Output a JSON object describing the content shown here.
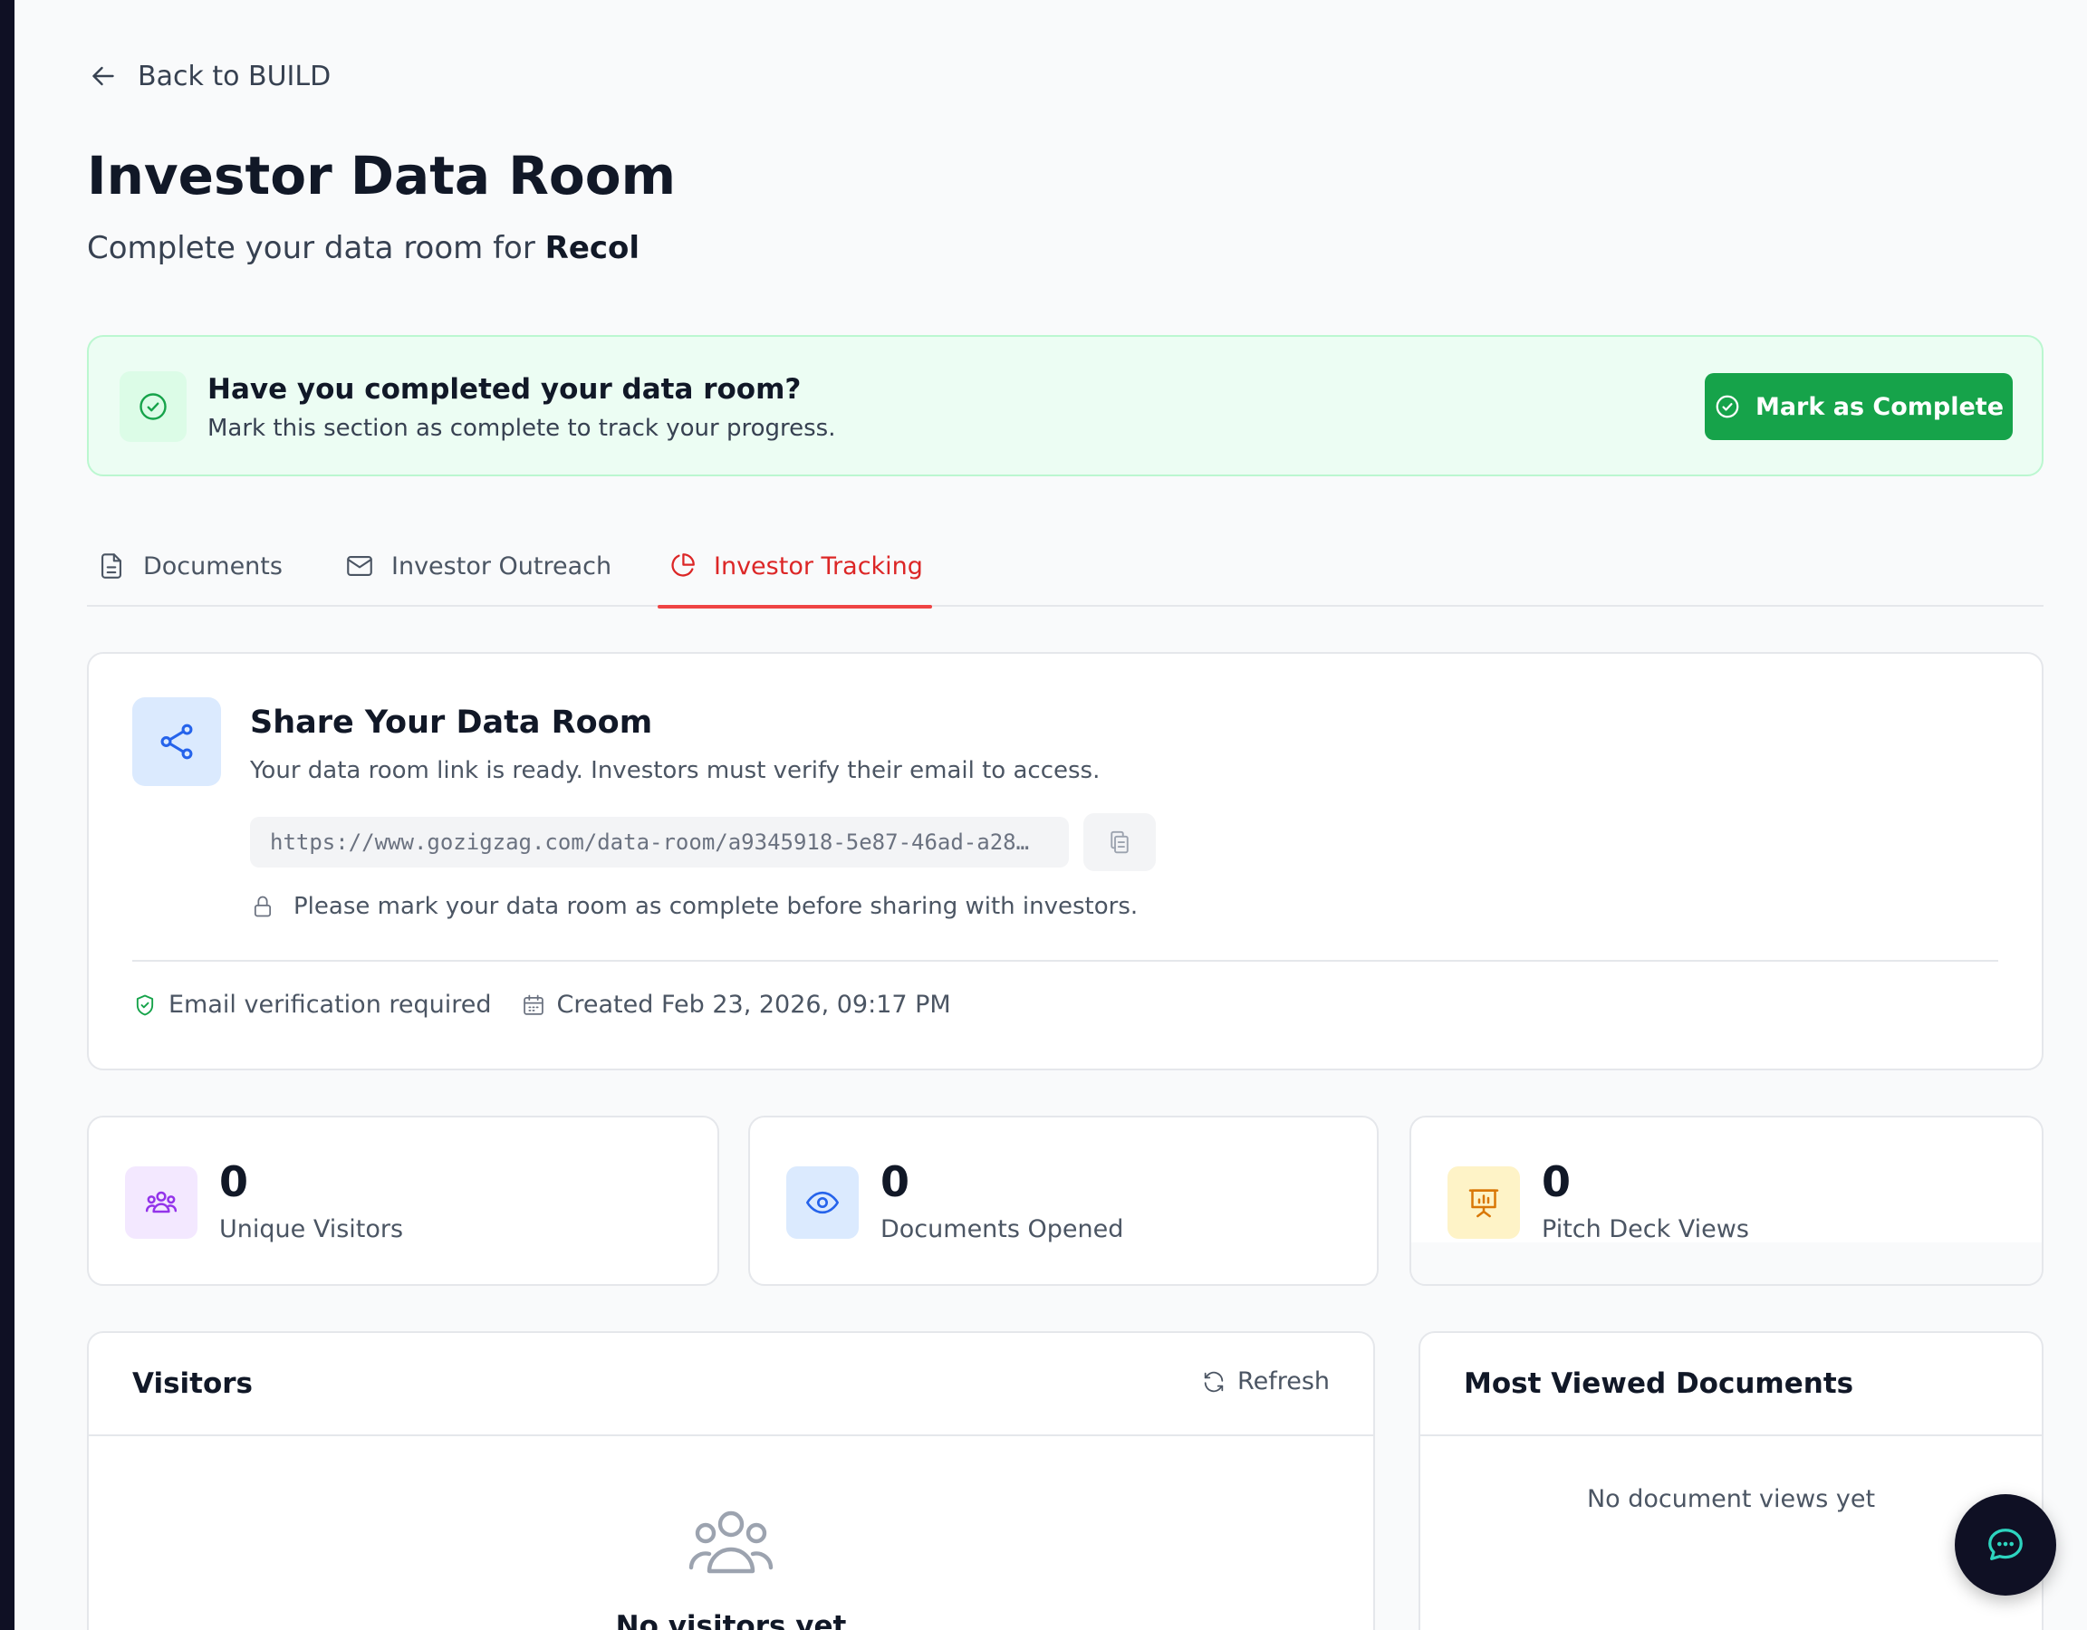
{
  "nav": {
    "back_label": "Back to BUILD"
  },
  "header": {
    "title": "Investor Data Room",
    "subtitle_prefix": "Complete your data room for",
    "company": "Recol"
  },
  "completion_banner": {
    "title": "Have you completed your data room?",
    "description": "Mark this section as complete to track your progress.",
    "button_label": "Mark as Complete"
  },
  "tabs": [
    {
      "label": "Documents",
      "icon": "document-icon",
      "active": false
    },
    {
      "label": "Investor Outreach",
      "icon": "mail-icon",
      "active": false
    },
    {
      "label": "Investor Tracking",
      "icon": "pie-chart-icon",
      "active": true
    }
  ],
  "share": {
    "title": "Share Your Data Room",
    "description": "Your data room link is ready. Investors must verify their email to access.",
    "link": "https://www.gozigzag.com/data-room/a9345918-5e87-46ad-a28…",
    "lock_note": "Please mark your data room as complete before sharing with investors.",
    "email_verification": "Email verification required",
    "created": "Created Feb 23, 2026, 09:17 PM"
  },
  "stats": [
    {
      "value": "0",
      "label": "Unique Visitors",
      "icon": "users-icon",
      "icon_bg": "#f3e8ff",
      "icon_color": "#9333ea"
    },
    {
      "value": "0",
      "label": "Documents Opened",
      "icon": "eye-icon",
      "icon_bg": "#dbeafe",
      "icon_color": "#2563eb"
    },
    {
      "value": "0",
      "label": "Pitch Deck Views",
      "icon": "presentation-icon",
      "icon_bg": "#fef3c7",
      "icon_color": "#d97706"
    }
  ],
  "visitors_panel": {
    "title": "Visitors",
    "refresh_label": "Refresh",
    "empty_title": "No visitors yet"
  },
  "documents_panel": {
    "title": "Most Viewed Documents",
    "empty_text": "No document views yet"
  },
  "colors": {
    "accent": "#ef4444",
    "success": "#16a34a",
    "chat_fab": "#0f1024"
  }
}
